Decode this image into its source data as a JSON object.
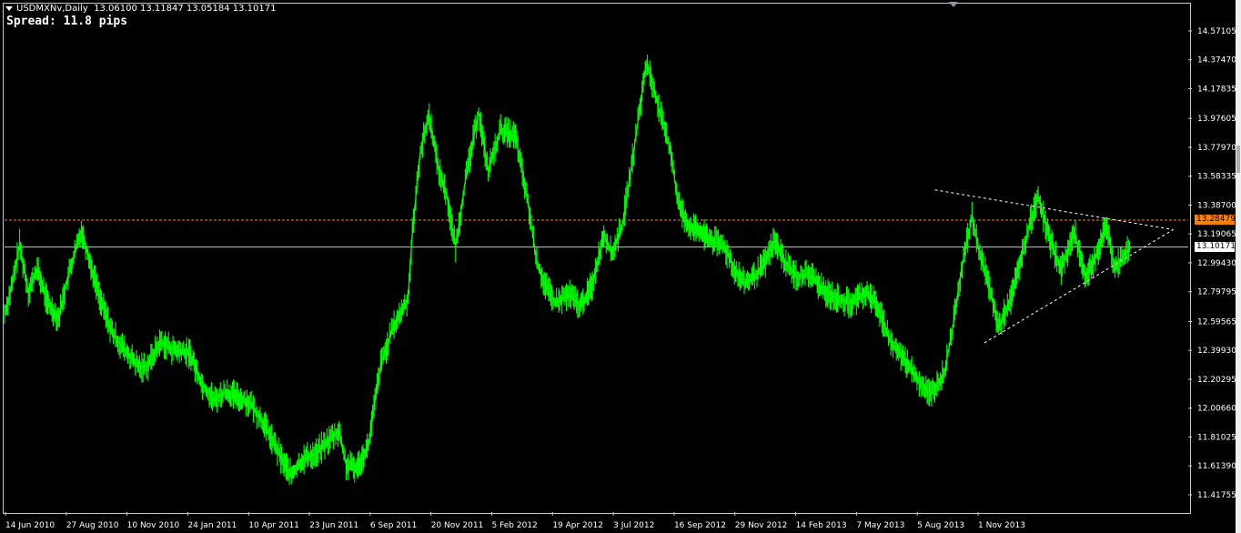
{
  "header": {
    "symbol": "USDMXNv,Daily",
    "ohlc": "13.06100 13.11847 13.05184 13.10171",
    "spread_text": "Spread: 11.8 pips"
  },
  "price_tags": {
    "orange": "13.28479",
    "white": "13.10171"
  },
  "colors": {
    "background": "#000000",
    "series": "#00ff00",
    "grid_border": "#c8c8c8",
    "axis_text": "#ffffff",
    "orange_line": "#ff7f00",
    "white_line": "#c8c8c8",
    "trendline": "#ffffff"
  },
  "chart_data": {
    "type": "line",
    "title": "",
    "xlabel": "",
    "ylabel": "",
    "ylim": [
      11.3,
      14.75
    ],
    "y_ticks": [
      "14.57105",
      "14.37470",
      "14.17835",
      "13.97605",
      "13.77970",
      "13.58335",
      "13.38700",
      "13.19065",
      "12.99430",
      "12.79795",
      "12.59565",
      "12.39930",
      "12.20295",
      "12.00660",
      "11.81025",
      "11.61390",
      "11.41755"
    ],
    "x_ticks": [
      "14 Jun 2010",
      "27 Aug 2010",
      "10 Nov 2010",
      "24 Jan 2011",
      "10 Apr 2011",
      "23 Jun 2011",
      "6 Sep 2011",
      "20 Nov 2011",
      "5 Feb 2012",
      "19 Apr 2012",
      "3 Jul 2012",
      "16 Sep 2012",
      "29 Nov 2012",
      "14 Feb 2013",
      "7 May 2013",
      "5 Aug 2013",
      "1 Nov 2013"
    ],
    "x_range": [
      "2010-06-01",
      "2014-02-01"
    ],
    "series": [
      {
        "values": [
          [
            "2010-06-01",
            12.65
          ],
          [
            "2010-06-10",
            12.85
          ],
          [
            "2010-06-18",
            13.12
          ],
          [
            "2010-06-28",
            12.8
          ],
          [
            "2010-07-08",
            12.95
          ],
          [
            "2010-07-20",
            12.72
          ],
          [
            "2010-08-01",
            12.62
          ],
          [
            "2010-08-12",
            12.9
          ],
          [
            "2010-08-27",
            13.22
          ],
          [
            "2010-09-08",
            12.95
          ],
          [
            "2010-09-20",
            12.7
          ],
          [
            "2010-10-01",
            12.52
          ],
          [
            "2010-10-15",
            12.4
          ],
          [
            "2010-11-01",
            12.28
          ],
          [
            "2010-11-10",
            12.3
          ],
          [
            "2010-11-25",
            12.46
          ],
          [
            "2010-12-10",
            12.4
          ],
          [
            "2010-12-28",
            12.38
          ],
          [
            "2011-01-10",
            12.18
          ],
          [
            "2011-01-24",
            12.06
          ],
          [
            "2011-02-07",
            12.12
          ],
          [
            "2011-02-20",
            12.08
          ],
          [
            "2011-03-05",
            12.05
          ],
          [
            "2011-03-20",
            11.92
          ],
          [
            "2011-04-01",
            11.78
          ],
          [
            "2011-04-10",
            11.67
          ],
          [
            "2011-04-22",
            11.55
          ],
          [
            "2011-05-05",
            11.66
          ],
          [
            "2011-05-20",
            11.7
          ],
          [
            "2011-06-05",
            11.8
          ],
          [
            "2011-06-15",
            11.85
          ],
          [
            "2011-06-23",
            11.62
          ],
          [
            "2011-07-05",
            11.6
          ],
          [
            "2011-07-18",
            11.75
          ],
          [
            "2011-08-01",
            12.3
          ],
          [
            "2011-08-15",
            12.55
          ],
          [
            "2011-09-01",
            12.75
          ],
          [
            "2011-09-06",
            13.2
          ],
          [
            "2011-09-15",
            13.75
          ],
          [
            "2011-09-25",
            14.0
          ],
          [
            "2011-10-05",
            13.65
          ],
          [
            "2011-10-15",
            13.45
          ],
          [
            "2011-10-25",
            13.1
          ],
          [
            "2011-11-05",
            13.55
          ],
          [
            "2011-11-20",
            14.02
          ],
          [
            "2011-12-01",
            13.62
          ],
          [
            "2011-12-15",
            13.9
          ],
          [
            "2012-01-01",
            13.85
          ],
          [
            "2012-01-15",
            13.4
          ],
          [
            "2012-01-25",
            13.0
          ],
          [
            "2012-02-05",
            12.82
          ],
          [
            "2012-02-15",
            12.72
          ],
          [
            "2012-03-01",
            12.78
          ],
          [
            "2012-03-15",
            12.7
          ],
          [
            "2012-03-28",
            12.85
          ],
          [
            "2012-04-10",
            13.2
          ],
          [
            "2012-04-19",
            13.05
          ],
          [
            "2012-05-01",
            13.25
          ],
          [
            "2012-05-15",
            13.8
          ],
          [
            "2012-05-28",
            14.35
          ],
          [
            "2012-06-05",
            14.2
          ],
          [
            "2012-06-15",
            13.95
          ],
          [
            "2012-06-25",
            13.75
          ],
          [
            "2012-07-03",
            13.4
          ],
          [
            "2012-07-15",
            13.25
          ],
          [
            "2012-07-28",
            13.2
          ],
          [
            "2012-08-10",
            13.15
          ],
          [
            "2012-08-25",
            13.1
          ],
          [
            "2012-09-05",
            12.95
          ],
          [
            "2012-09-16",
            12.85
          ],
          [
            "2012-09-28",
            12.9
          ],
          [
            "2012-10-10",
            13.0
          ],
          [
            "2012-10-20",
            13.15
          ],
          [
            "2012-11-01",
            13.0
          ],
          [
            "2012-11-15",
            12.9
          ],
          [
            "2012-11-29",
            12.92
          ],
          [
            "2012-12-15",
            12.8
          ],
          [
            "2013-01-01",
            12.75
          ],
          [
            "2013-01-15",
            12.72
          ],
          [
            "2013-02-01",
            12.8
          ],
          [
            "2013-02-14",
            12.7
          ],
          [
            "2013-03-01",
            12.45
          ],
          [
            "2013-03-15",
            12.35
          ],
          [
            "2013-04-01",
            12.2
          ],
          [
            "2013-04-15",
            12.1
          ],
          [
            "2013-05-01",
            12.25
          ],
          [
            "2013-05-10",
            12.55
          ],
          [
            "2013-05-20",
            12.95
          ],
          [
            "2013-06-01",
            13.3
          ],
          [
            "2013-06-10",
            13.05
          ],
          [
            "2013-06-20",
            12.85
          ],
          [
            "2013-07-01",
            12.55
          ],
          [
            "2013-07-15",
            12.75
          ],
          [
            "2013-07-28",
            13.05
          ],
          [
            "2013-08-05",
            13.25
          ],
          [
            "2013-08-15",
            13.45
          ],
          [
            "2013-08-28",
            13.15
          ],
          [
            "2013-09-10",
            12.95
          ],
          [
            "2013-09-25",
            13.2
          ],
          [
            "2013-10-08",
            12.9
          ],
          [
            "2013-10-20",
            13.05
          ],
          [
            "2013-11-01",
            13.25
          ],
          [
            "2013-11-10",
            12.95
          ],
          [
            "2013-11-20",
            13.05
          ],
          [
            "2013-11-28",
            13.1
          ]
        ]
      }
    ],
    "trendlines": [
      {
        "from": [
          "2013-04-20",
          13.49
        ],
        "to": [
          "2014-01-15",
          13.22
        ]
      },
      {
        "from": [
          "2013-06-15",
          12.45
        ],
        "to": [
          "2014-01-15",
          13.22
        ]
      }
    ],
    "hlines": [
      13.28479,
      13.10171
    ]
  }
}
